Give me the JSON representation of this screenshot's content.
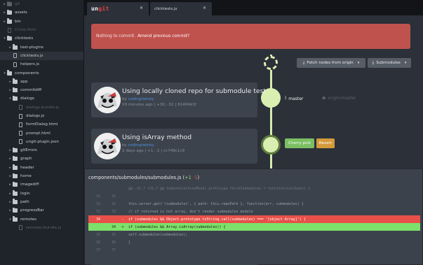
{
  "sidebar": {
    "items": [
      {
        "label": "git",
        "indent": 1,
        "type": "folder",
        "chevron": "▸",
        "dim": true
      },
      {
        "label": "assets",
        "indent": 1,
        "type": "folder",
        "chevron": "▸",
        "dim": false
      },
      {
        "label": "bin",
        "indent": 1,
        "type": "folder",
        "chevron": "▸",
        "dim": false
      },
      {
        "label": "Circle.html",
        "indent": 1,
        "type": "file",
        "chevron": "",
        "dim": true
      },
      {
        "label": "clicktests",
        "indent": 1,
        "type": "folder",
        "chevron": "▾",
        "dim": false
      },
      {
        "label": "test-plugins",
        "indent": 2,
        "type": "folder",
        "chevron": "▸",
        "dim": false
      },
      {
        "label": "clicktests.js",
        "indent": 2,
        "type": "file",
        "chevron": "",
        "dim": false,
        "selected": true
      },
      {
        "label": "helpers.js",
        "indent": 2,
        "type": "file",
        "chevron": "",
        "dim": false
      },
      {
        "label": "components",
        "indent": 1,
        "type": "folder",
        "chevron": "▾",
        "dim": false
      },
      {
        "label": "app",
        "indent": 2,
        "type": "folder",
        "chevron": "▸",
        "dim": false
      },
      {
        "label": "commitdiff",
        "indent": 2,
        "type": "folder",
        "chevron": "▸",
        "dim": false
      },
      {
        "label": "dialogs",
        "indent": 2,
        "type": "folder",
        "chevron": "▾",
        "dim": false
      },
      {
        "label": "dialogs.bundle.js",
        "indent": 3,
        "type": "file",
        "chevron": "",
        "dim": true
      },
      {
        "label": "dialogs.js",
        "indent": 3,
        "type": "file",
        "chevron": "",
        "dim": false
      },
      {
        "label": "formDialog.html",
        "indent": 3,
        "type": "file",
        "chevron": "",
        "dim": false
      },
      {
        "label": "prompt.html",
        "indent": 3,
        "type": "file",
        "chevron": "",
        "dim": false
      },
      {
        "label": "ungit-plugin.json",
        "indent": 3,
        "type": "file",
        "chevron": "",
        "dim": false
      },
      {
        "label": "gitErrors",
        "indent": 2,
        "type": "folder",
        "chevron": "▸",
        "dim": false
      },
      {
        "label": "graph",
        "indent": 2,
        "type": "folder",
        "chevron": "▸",
        "dim": false
      },
      {
        "label": "header",
        "indent": 2,
        "type": "folder",
        "chevron": "▸",
        "dim": false
      },
      {
        "label": "home",
        "indent": 2,
        "type": "folder",
        "chevron": "▸",
        "dim": false
      },
      {
        "label": "imagediff",
        "indent": 2,
        "type": "folder",
        "chevron": "▸",
        "dim": false
      },
      {
        "label": "login",
        "indent": 2,
        "type": "folder",
        "chevron": "▸",
        "dim": false
      },
      {
        "label": "path",
        "indent": 2,
        "type": "folder",
        "chevron": "▸",
        "dim": false
      },
      {
        "label": "progressBar",
        "indent": 2,
        "type": "folder",
        "chevron": "▸",
        "dim": false
      },
      {
        "label": "remotes",
        "indent": 2,
        "type": "folder",
        "chevron": "▾",
        "dim": false
      },
      {
        "label": "remotes.bundle.js",
        "indent": 3,
        "type": "file",
        "chevron": "",
        "dim": true
      }
    ]
  },
  "tabs": [
    {
      "label": "",
      "close": "×",
      "logo": true
    },
    {
      "label": "clicktests.js",
      "close": "×"
    }
  ],
  "logo": {
    "u": "un",
    "g": "git"
  },
  "status": {
    "text": "Nothing to commit.",
    "amend": "Amend previous commit?"
  },
  "buttons": {
    "fetch": {
      "label": "Fetch nodes from origin",
      "icon": "⤓",
      "caret": "▾"
    },
    "submodules": {
      "label": "Submodules",
      "icon": "⤓",
      "caret": "▾"
    },
    "cherry_pick": "Cherry pick",
    "revert": "Revert"
  },
  "refs": {
    "master": {
      "label": "master",
      "icon": "⟟"
    },
    "origin": {
      "label": "origin/master",
      "icon": "☗"
    }
  },
  "commits": [
    {
      "title": "Using locally cloned repo for submodule test",
      "by": "by",
      "author": "codingtwinky",
      "meta": "19 minutes ago | +30, -32 | 61404d1f"
    },
    {
      "title": "Using isArray method",
      "by": "by",
      "author": "codingtwinky",
      "meta": "2 days ago | +1, -1 | cc749c1c9"
    }
  ],
  "diff": {
    "file": "components/submodules/submodules.js",
    "added": "+1",
    "removed": "-1",
    "lines": [
      {
        "kind": "hunk",
        "o": "",
        "n": "",
        "sign": "",
        "code": "@@ -31,7 +31,7 @@ SubmodulesViewModel.prototype.fetchSubmodules = function(callback) {"
      },
      {
        "kind": "ctx",
        "o": "31",
        "n": "31",
        "sign": "",
        "code": ""
      },
      {
        "kind": "ctx",
        "o": "32",
        "n": "32",
        "sign": "",
        "code": "  this.server.get('/submodules', { path: this.repoPath }, function(err, submodules) {"
      },
      {
        "kind": "ctx",
        "o": "33",
        "n": "33",
        "sign": "",
        "code": "    // if returned is not array, don't render submodules module"
      },
      {
        "kind": "del",
        "o": "34",
        "n": "",
        "sign": "-",
        "code": "    if (submodules && Object.prototype.toString.call(submodules) === '[object Array]') {"
      },
      {
        "kind": "add",
        "o": "",
        "n": "34",
        "sign": "+",
        "code": "    if (submodules && Array.isArray(submodules)) {"
      },
      {
        "kind": "ctx",
        "o": "35",
        "n": "35",
        "sign": "",
        "code": "      self.submodules(submodules);"
      },
      {
        "kind": "ctx",
        "o": "36",
        "n": "36",
        "sign": "",
        "code": "    }"
      },
      {
        "kind": "ctx",
        "o": "37",
        "n": "37",
        "sign": "",
        "code": ""
      }
    ]
  },
  "colors": {
    "status_bg": "#c0524e",
    "graph": "#d9efb1",
    "cherry": "#7bbf62",
    "revert": "#d49a3a",
    "link": "#4b8ee0"
  }
}
